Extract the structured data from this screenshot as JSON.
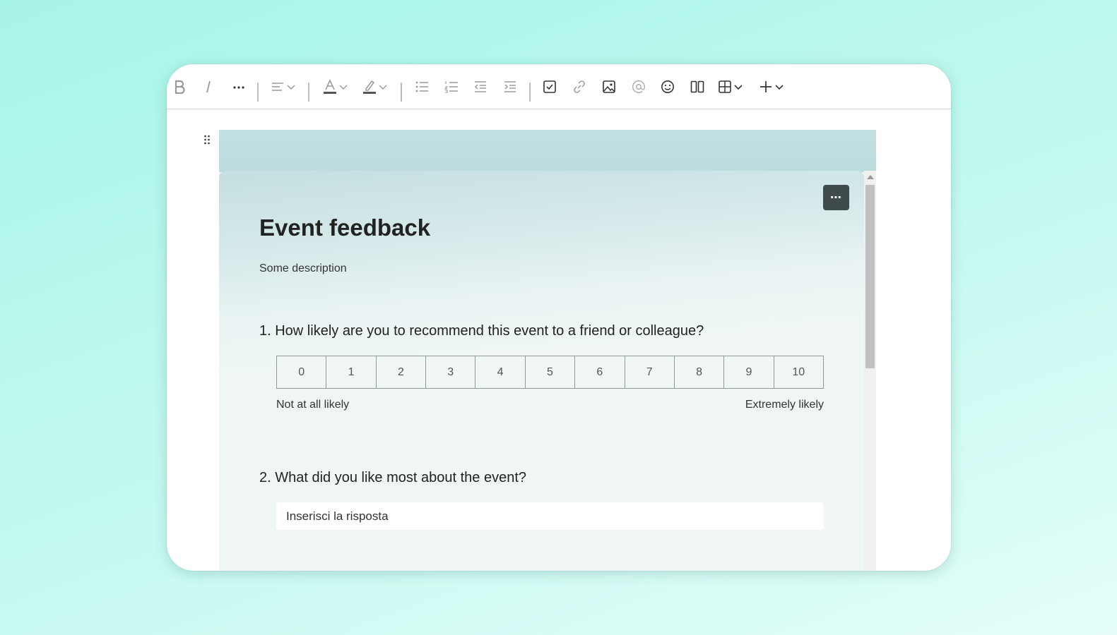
{
  "toolbar": {
    "items": [
      {
        "name": "bold",
        "icon": "bold-icon"
      },
      {
        "name": "italic",
        "icon": "italic-icon"
      },
      {
        "name": "more-formatting",
        "icon": "ellipsis-icon"
      },
      {
        "name": "align",
        "icon": "align-left-icon"
      },
      {
        "name": "font-color",
        "icon": "font-color-icon"
      },
      {
        "name": "highlight",
        "icon": "highlighter-icon"
      },
      {
        "name": "bullet-list",
        "icon": "bullet-list-icon"
      },
      {
        "name": "numbered-list",
        "icon": "numbered-list-icon"
      },
      {
        "name": "decrease-indent",
        "icon": "outdent-icon"
      },
      {
        "name": "increase-indent",
        "icon": "indent-icon"
      },
      {
        "name": "checklist",
        "icon": "checkbox-icon"
      },
      {
        "name": "link",
        "icon": "link-icon"
      },
      {
        "name": "image",
        "icon": "image-icon"
      },
      {
        "name": "mention",
        "icon": "at-icon"
      },
      {
        "name": "emoji",
        "icon": "emoji-icon"
      },
      {
        "name": "columns",
        "icon": "columns-icon"
      },
      {
        "name": "table",
        "icon": "table-icon"
      },
      {
        "name": "insert",
        "icon": "plus-icon"
      }
    ]
  },
  "form": {
    "title": "Event feedback",
    "description": "Some description",
    "more_button": "⋯",
    "questions": [
      {
        "text": "1. How likely are you to recommend this event to a friend or colleague?",
        "type": "nps",
        "scale": [
          "0",
          "1",
          "2",
          "3",
          "4",
          "5",
          "6",
          "7",
          "8",
          "9",
          "10"
        ],
        "low_label": "Not at all likely",
        "high_label": "Extremely likely"
      },
      {
        "text": "2. What did you like most about the event?",
        "type": "text",
        "placeholder": "Inserisci la risposta"
      }
    ]
  },
  "colors": {
    "background": "#b3f7eb",
    "card_bg": "#f1f6f6",
    "card_header": "#c3e0e2",
    "more_button_bg": "#3f4b4b",
    "toolbar_icon": "#9a9a9a"
  }
}
